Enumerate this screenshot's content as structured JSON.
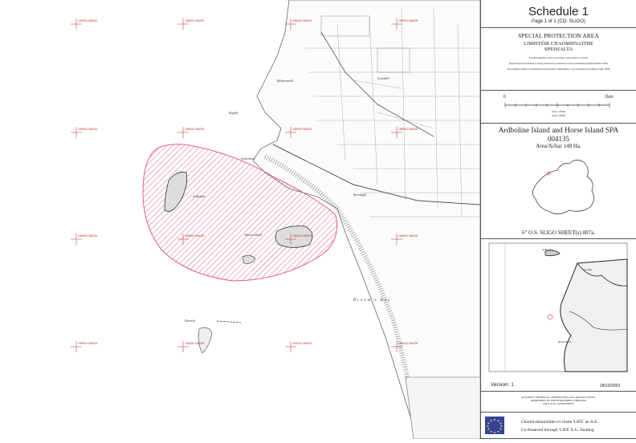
{
  "schedule": {
    "title": "Schedule 1",
    "page": "Page 1 of 1 (CO. SLIGO)"
  },
  "designation": {
    "english": "SPECIAL PROTECTION AREA",
    "irish_1": "LIMISTÉIR CHAOMHNAITHE",
    "irish_2": "SPEISIALTA",
    "notes": [
      "Teorainn shínithe a chur ar an eastáit / Sites subject to review",
      "Reproduced from Ordnance Survey material by permission of the Government (Permit Number 7058)",
      "Macasamhail d'ábhar na Suirbhéireachta Ordanáis a dhéanamh ar cead an Rialtais (Ceadúnas Uimh. 7058)"
    ]
  },
  "scale": {
    "left_label": "0",
    "right_label": "1km",
    "scale_en": "Scale 1:25000",
    "scale_ga": "Scála 1:25000"
  },
  "site": {
    "name": "Ardboline Island and Horse Island SPA",
    "code": "004135",
    "area": "Area/Achar 148 Ha."
  },
  "sheet": "6\" O.S. SLIGO SHEET(s) 007a.",
  "inset": {
    "version": "Version: 1",
    "date": "28/10/2003",
    "labels": [
      "Ardboline",
      "Grange",
      "Black Rock"
    ]
  },
  "department": [
    "AN ROINN COMHSHAOIL, OIDHREACHTA AGUS RIALTAIS ÁITIÚIL",
    "DEPARTMENT OF THE ENVIRONMENT, HERITAGE",
    "AND LOCAL GOVERNMENT"
  ],
  "funding": {
    "ga": "Chomh-mhaoinithe trí chiste 'LIFE' an A.E.",
    "en": "Co-financed through 'LIFE' E.U. funding"
  },
  "map": {
    "place_labels": [
      "Ardboline",
      "Horse Island",
      "Broom's Bay",
      "Dernish",
      "Ardtermon",
      "Raghly",
      "Streedagh",
      "Ballyconnell",
      "Lissadell"
    ],
    "grid_labels": [
      "158000 346000"
    ],
    "colors": {
      "spa_hatch": "#e0607a",
      "grid": "#c04a4a",
      "ink": "#444"
    }
  }
}
